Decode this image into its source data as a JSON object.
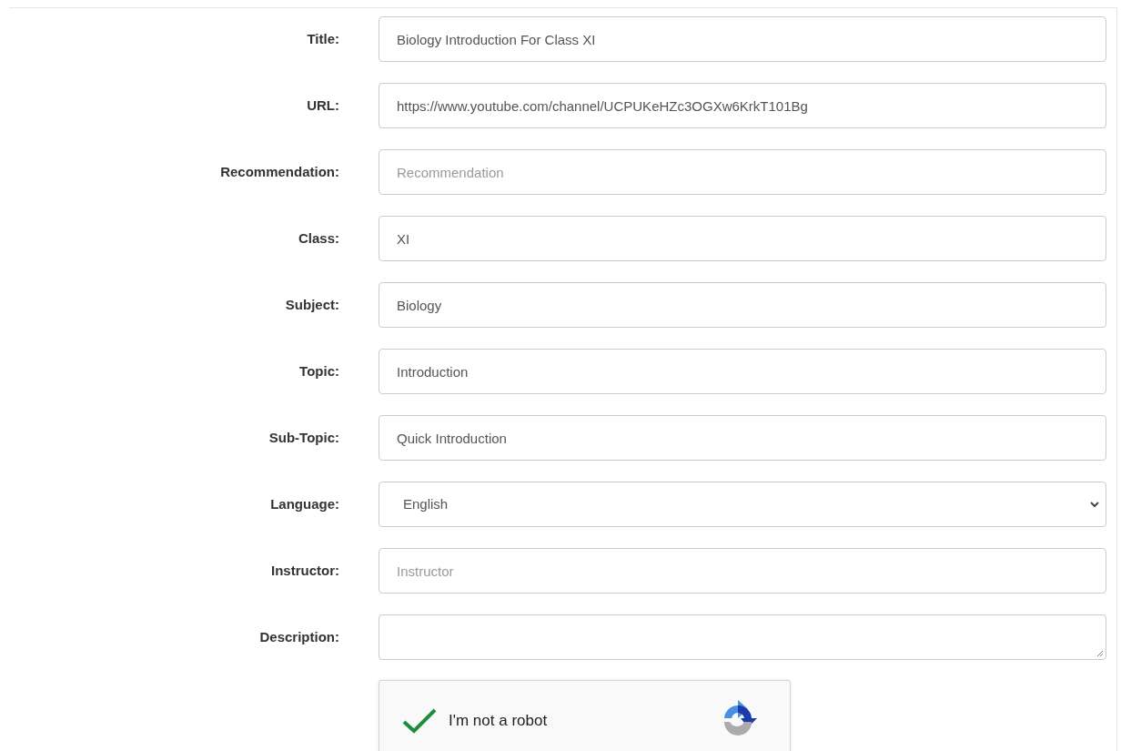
{
  "fields": [
    {
      "label": "Title:",
      "kind": "input",
      "value": "Biology Introduction For Class XI"
    },
    {
      "label": "URL:",
      "kind": "input",
      "value": "https://www.youtube.com/channel/UCPUKeHZc3OGXw6KrkT101Bg"
    },
    {
      "label": "Recommendation:",
      "kind": "input",
      "placeholder": "Recommendation"
    },
    {
      "label": "Class:",
      "kind": "input",
      "value": "XI"
    },
    {
      "label": "Subject:",
      "kind": "input",
      "value": "Biology"
    },
    {
      "label": "Topic:",
      "kind": "input",
      "value": "Introduction"
    },
    {
      "label": "Sub-Topic:",
      "kind": "input",
      "value": "Quick Introduction"
    },
    {
      "label": "Language:",
      "kind": "select",
      "value": "English"
    },
    {
      "label": "Instructor:",
      "kind": "input",
      "placeholder": "Instructor"
    },
    {
      "label": "Description:",
      "kind": "textarea"
    }
  ],
  "captcha": {
    "label": "I'm not a robot",
    "checked": true
  }
}
